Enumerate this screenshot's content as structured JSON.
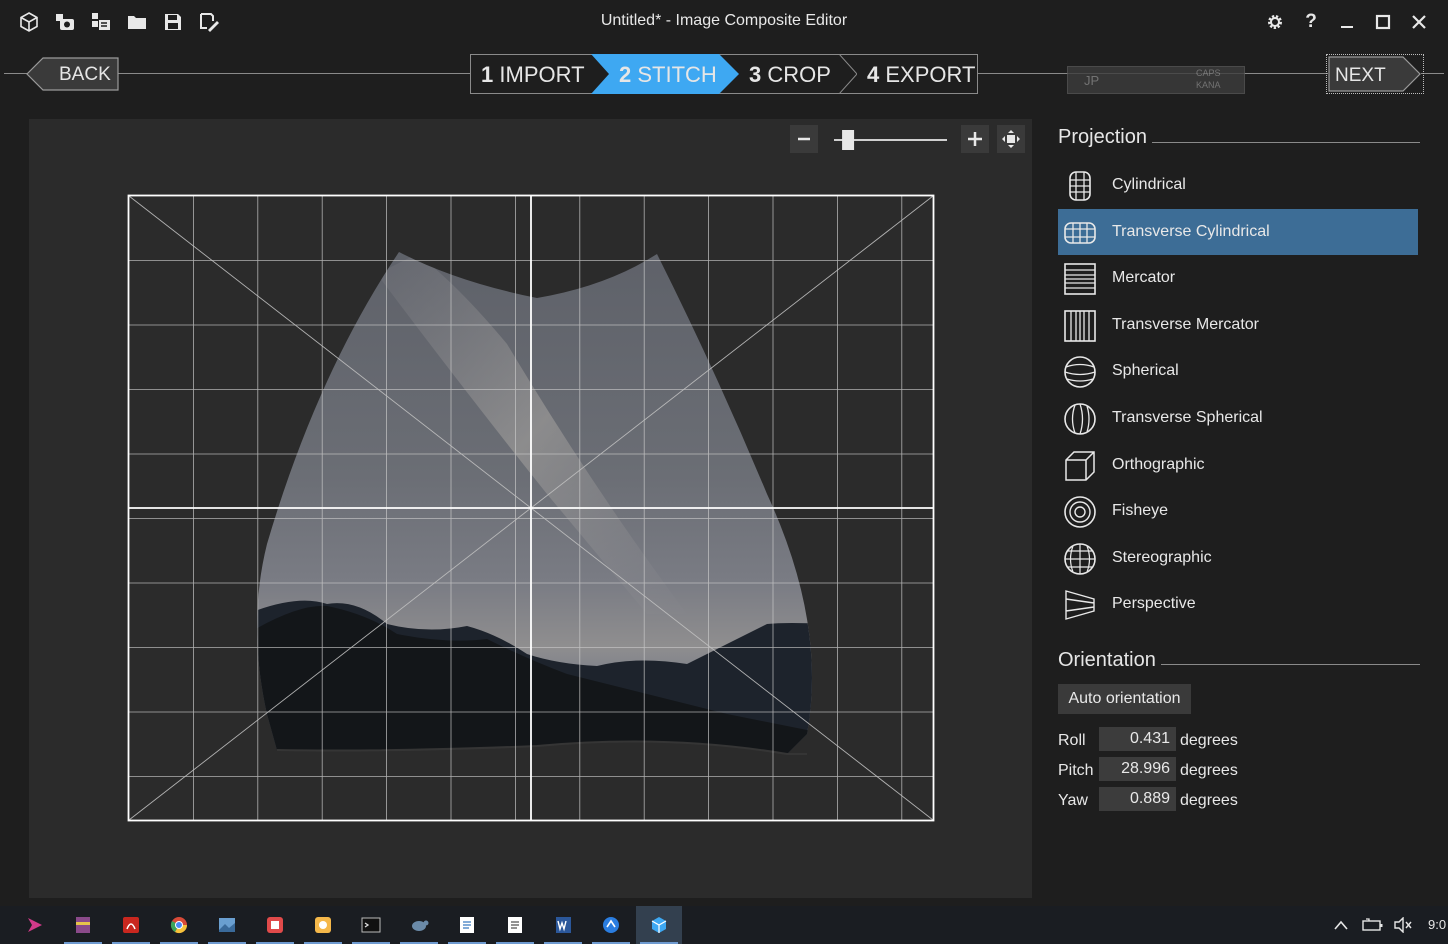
{
  "window": {
    "title": "Untitled* - Image Composite Editor"
  },
  "titlebar_icons": [
    "new-panorama-icon",
    "new-video-panorama-icon",
    "new-structured-panorama-icon",
    "open-icon",
    "save-icon",
    "save-as-icon"
  ],
  "window_controls": {
    "settings": "⚙",
    "help": "?"
  },
  "wizard": {
    "back_label": "BACK",
    "next_label": "NEXT",
    "steps": [
      {
        "num": "1",
        "label": "IMPORT"
      },
      {
        "num": "2",
        "label": "STITCH",
        "active": true
      },
      {
        "num": "3",
        "label": "CROP"
      },
      {
        "num": "4",
        "label": "EXPORT"
      }
    ]
  },
  "ime": {
    "lang": "JP",
    "caps": "CAPS",
    "kana": "KANA"
  },
  "zoom": {
    "level": 0.08
  },
  "projection": {
    "title": "Projection",
    "selected": "Transverse Cylindrical",
    "items": [
      {
        "label": "Cylindrical",
        "icon": "cylindrical-icon"
      },
      {
        "label": "Transverse Cylindrical",
        "icon": "transverse-cylindrical-icon"
      },
      {
        "label": "Mercator",
        "icon": "mercator-icon"
      },
      {
        "label": "Transverse Mercator",
        "icon": "transverse-mercator-icon"
      },
      {
        "label": "Spherical",
        "icon": "spherical-icon"
      },
      {
        "label": "Transverse Spherical",
        "icon": "transverse-spherical-icon"
      },
      {
        "label": "Orthographic",
        "icon": "orthographic-icon"
      },
      {
        "label": "Fisheye",
        "icon": "fisheye-icon"
      },
      {
        "label": "Stereographic",
        "icon": "stereographic-icon"
      },
      {
        "label": "Perspective",
        "icon": "perspective-icon"
      }
    ]
  },
  "orientation": {
    "title": "Orientation",
    "auto_label": "Auto orientation",
    "rows": [
      {
        "label": "Roll",
        "value": "0.431",
        "unit": "degrees"
      },
      {
        "label": "Pitch",
        "value": "28.996",
        "unit": "degrees"
      },
      {
        "label": "Yaw",
        "value": "0.889",
        "unit": "degrees"
      }
    ]
  },
  "taskbar": {
    "apps": [
      "start-icon",
      "winrar-icon",
      "acrobat-icon",
      "chrome-icon",
      "photos-icon",
      "app-icon",
      "sticky-notes-icon",
      "cmd-icon",
      "tortoise-icon",
      "notepad-icon",
      "notepad2-icon",
      "word-icon",
      "feedback-icon",
      "ice-icon"
    ],
    "clock": "9:0"
  },
  "colors": {
    "accent": "#3ea8f2",
    "selected": "#3d6d96",
    "background": "#1e1e1e",
    "canvas": "#2b2b2b"
  }
}
